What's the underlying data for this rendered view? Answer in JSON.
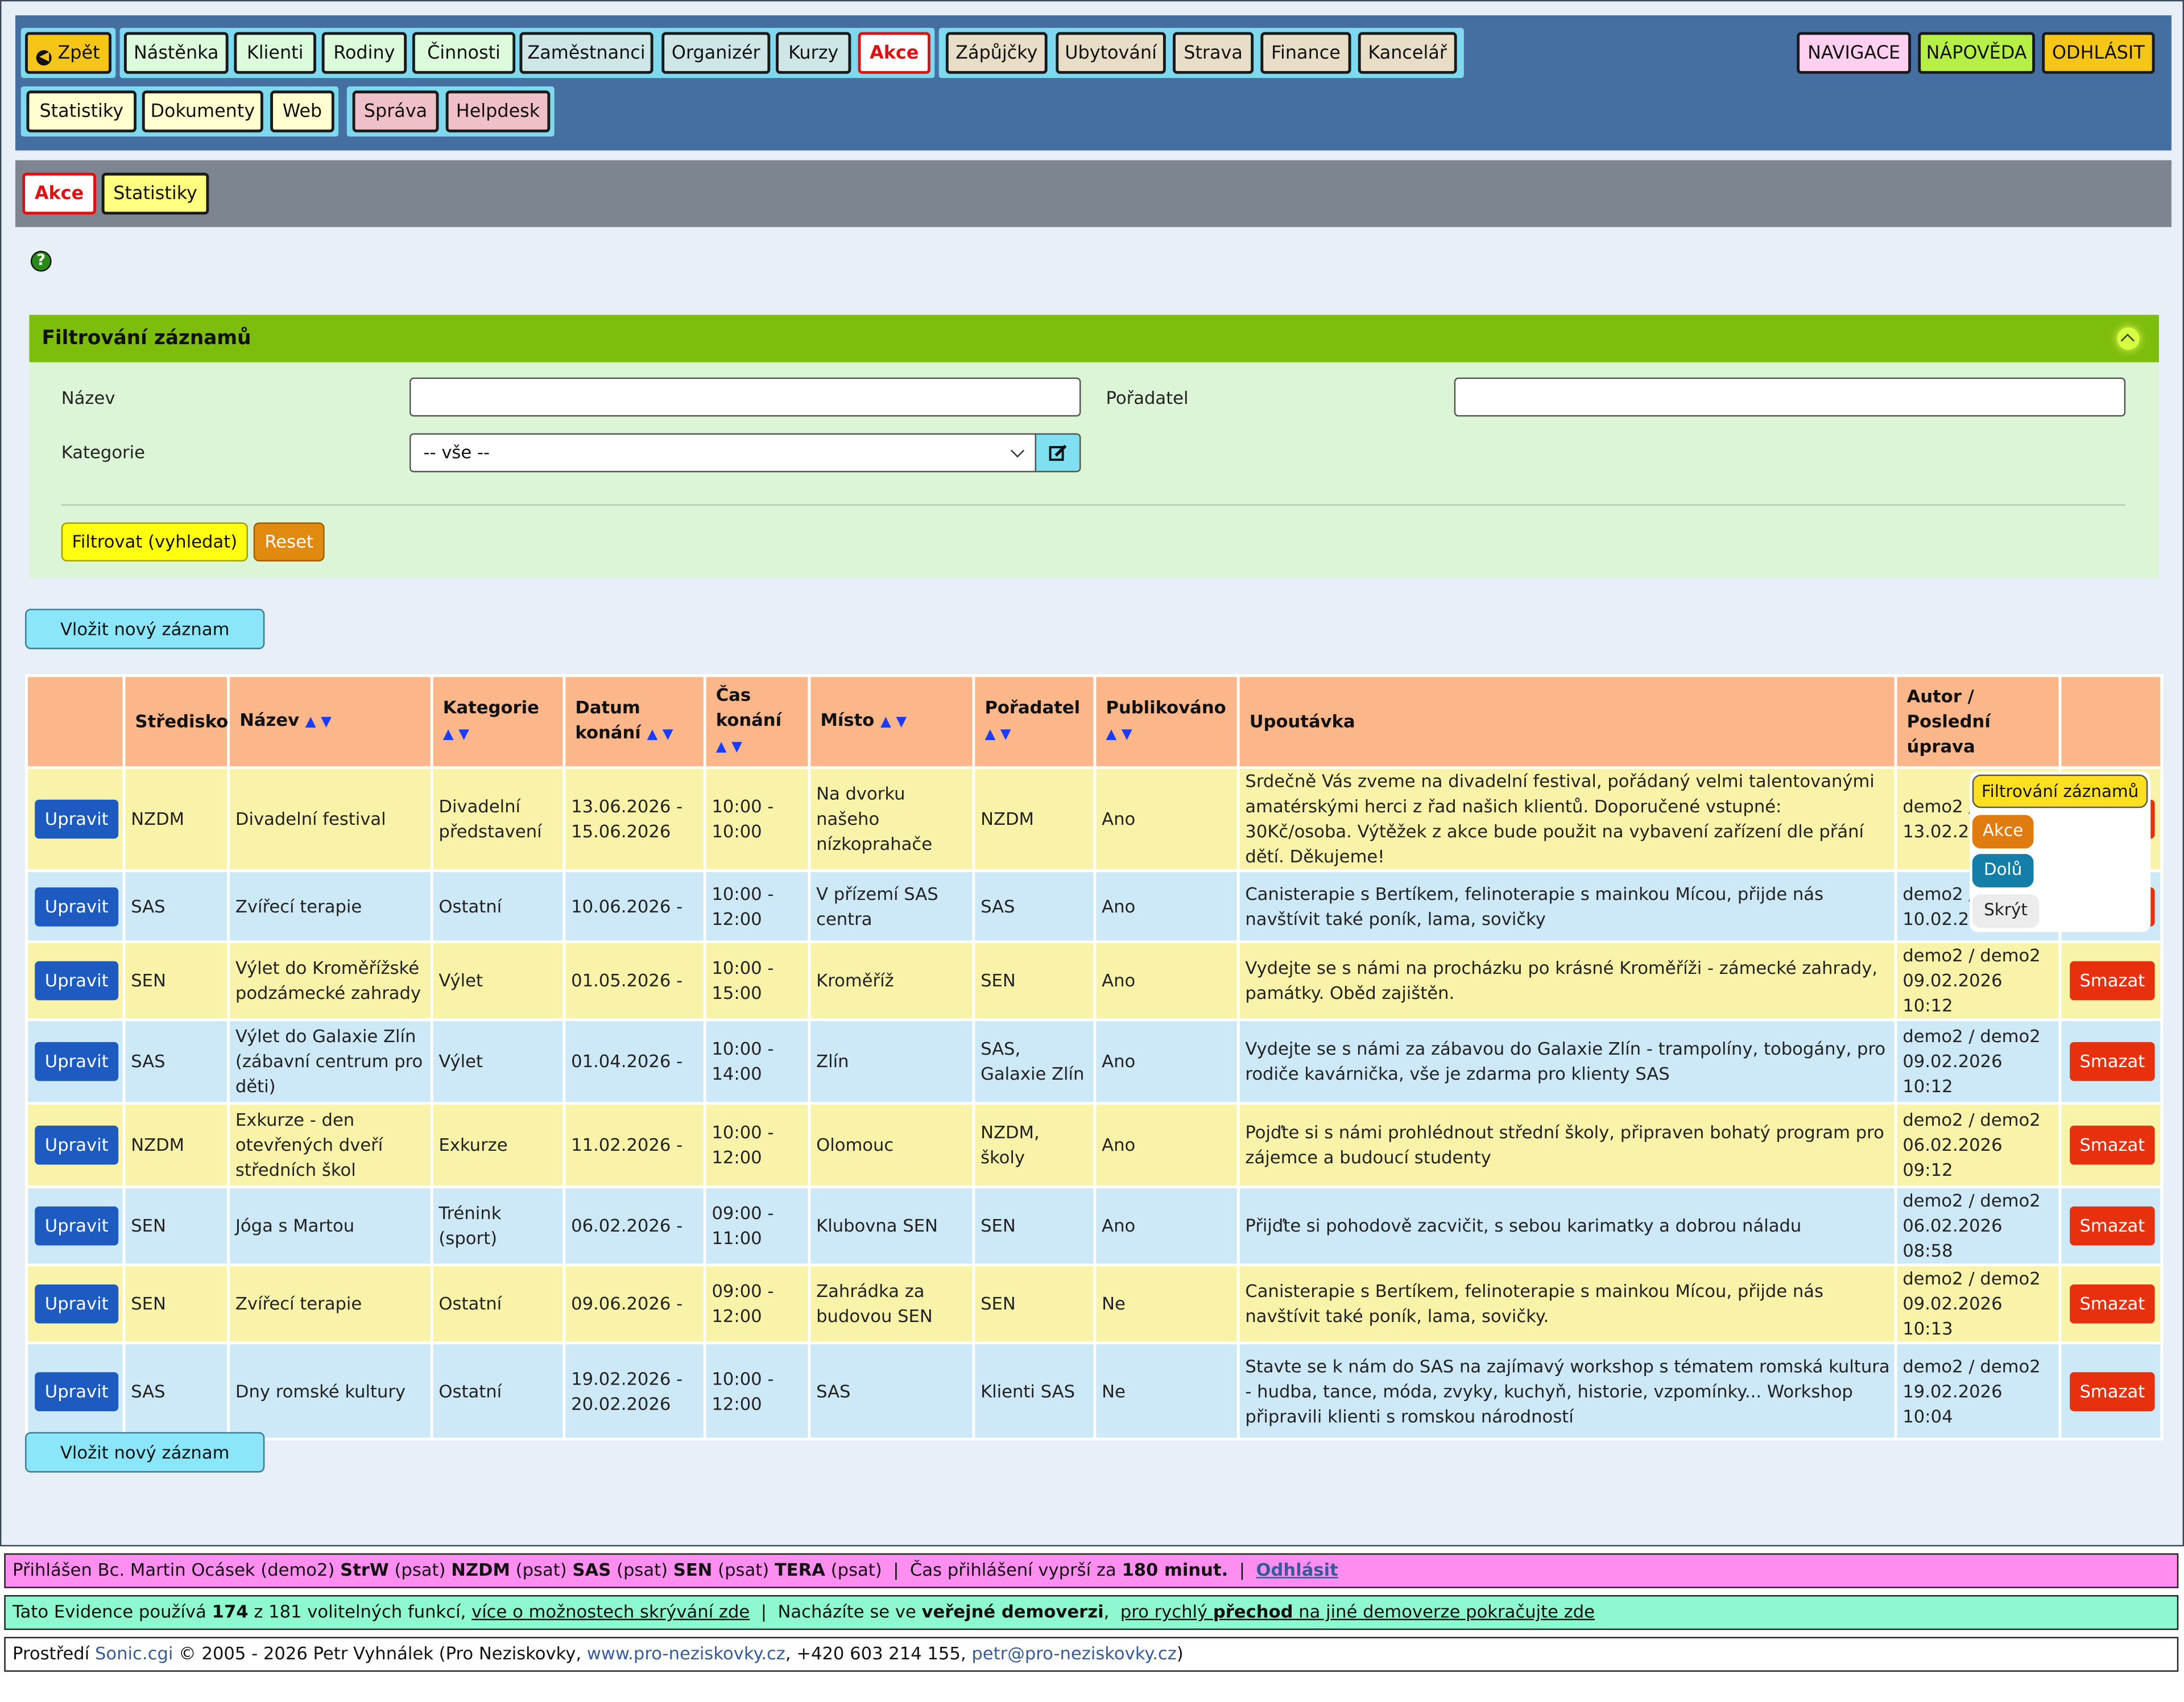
{
  "nav": {
    "back": "Zpět",
    "row1_group1": [
      "Nástěnka",
      "Klienti",
      "Rodiny",
      "Činnosti"
    ],
    "row1_group2": [
      "Zaměstnanci",
      "Organizér",
      "Kurzy",
      "Akce"
    ],
    "row1_group3": [
      "Zápůjčky",
      "Ubytování",
      "Strava",
      "Finance",
      "Kancelář"
    ],
    "row2_group1": [
      "Statistiky",
      "Dokumenty",
      "Web"
    ],
    "row2_group2": [
      "Správa",
      "Helpdesk"
    ],
    "right": [
      "NAVIGACE",
      "NÁPOVĚDA",
      "ODHLÁSIT"
    ]
  },
  "subnav": {
    "items": [
      "Akce",
      "Statistiky"
    ]
  },
  "filter": {
    "title": "Filtrování záznamů",
    "label_name": "Název",
    "label_organizer": "Pořadatel",
    "label_category": "Kategorie",
    "category_value": "-- vše --",
    "name_value": "",
    "organizer_value": "",
    "search_btn": "Filtrovat (vyhledat)",
    "reset_btn": "Reset"
  },
  "new_record": "Vložit nový záznam",
  "table": {
    "headers": [
      "",
      "Středisko",
      "Název",
      "Kategorie",
      "Datum konání",
      "Čas konání",
      "Místo",
      "Pořadatel",
      "Publikováno",
      "Upoutávka",
      "Autor / Poslední úprava",
      ""
    ],
    "edit_label": "Upravit",
    "delete_label": "Smazat",
    "rows": [
      {
        "center": "NZDM",
        "name": "Divadelní festival",
        "category": "Divadelní představení",
        "date": "13.06.2026 - 15.06.2026",
        "time": "10:00 - 10:00",
        "place": "Na dvorku našeho nízkoprahače",
        "organizer": "NZDM",
        "published": "Ano",
        "teaser": "Srdečně Vás zveme na divadelní festival, pořádaný velmi talentovanými amatérskými herci z řad našich klientů. Doporučené vstupné: 30Kč/osoba. Výtěžek z akce bude použit na vybavení zařízení dle přání dětí. Děkujeme!",
        "author": "demo2 / demo2 13.02.2026"
      },
      {
        "center": "SAS",
        "name": "Zvířecí terapie",
        "category": "Ostatní",
        "date": "10.06.2026 -",
        "time": "10:00 - 12:00",
        "place": "V přízemí SAS centra",
        "organizer": "SAS",
        "published": "Ano",
        "teaser": "Canisterapie s Bertíkem, felinoterapie s mainkou Mícou, přijde nás navštívit také poník, lama, sovičky",
        "author": "demo2 / demo2 10.02.2026"
      },
      {
        "center": "SEN",
        "name": "Výlet do Kroměřížské podzámecké zahrady",
        "category": "Výlet",
        "date": "01.05.2026 -",
        "time": "10:00 - 15:00",
        "place": "Kroměříž",
        "organizer": "SEN",
        "published": "Ano",
        "teaser": "Vydejte se s námi na procházku po krásné Kroměříži - zámecké zahrady, památky. Oběd zajištěn.",
        "author": "demo2 / demo2 09.02.2026 10:12"
      },
      {
        "center": "SAS",
        "name": "Výlet do Galaxie Zlín (zábavní centrum pro děti)",
        "category": "Výlet",
        "date": "01.04.2026 -",
        "time": "10:00 - 14:00",
        "place": "Zlín",
        "organizer": "SAS, Galaxie Zlín",
        "published": "Ano",
        "teaser": "Vydejte se s námi za zábavou do Galaxie Zlín - trampolíny, tobogány, pro rodiče kavárnička, vše je zdarma pro klienty SAS",
        "author": "demo2 / demo2 09.02.2026 10:12"
      },
      {
        "center": "NZDM",
        "name": "Exkurze - den otevřených dveří středních škol",
        "category": "Exkurze",
        "date": "11.02.2026 -",
        "time": "10:00 - 12:00",
        "place": "Olomouc",
        "organizer": "NZDM, školy",
        "published": "Ano",
        "teaser": "Pojďte si s námi prohlédnout střední školy, připraven bohatý program pro zájemce a budoucí studenty",
        "author": "demo2 / demo2 06.02.2026 09:12"
      },
      {
        "center": "SEN",
        "name": "Jóga s Martou",
        "category": "Trénink (sport)",
        "date": "06.02.2026 -",
        "time": "09:00 - 11:00",
        "place": "Klubovna SEN",
        "organizer": "SEN",
        "published": "Ano",
        "teaser": "Přijďte si pohodově zacvičit, s sebou karimatky a dobrou náladu",
        "author": "demo2 / demo2 06.02.2026 08:58"
      },
      {
        "center": "SEN",
        "name": "Zvířecí terapie",
        "category": "Ostatní",
        "date": "09.06.2026 -",
        "time": "09:00 - 12:00",
        "place": "Zahrádka za budovou SEN",
        "organizer": "SEN",
        "published": "Ne",
        "teaser": "Canisterapie s Bertíkem, felinoterapie s mainkou Mícou, přijde nás navštívit také poník, lama, sovičky.",
        "author": "demo2 / demo2 09.02.2026 10:13"
      },
      {
        "center": "SAS",
        "name": "Dny romské kultury",
        "category": "Ostatní",
        "date": "19.02.2026 - 20.02.2026",
        "time": "10:00 - 12:00",
        "place": "SAS",
        "organizer": "Klienti SAS",
        "published": "Ne",
        "teaser": "Stavte se k nám do SAS na zajímavý workshop s tématem romská kultura - hudba, tance, móda, zvyky, kuchyň, historie, vzpomínky... Workshop připravili klienti s romskou národností",
        "author": "demo2 / demo2 19.02.2026 10:04"
      }
    ]
  },
  "popup": {
    "items": [
      "Filtrování záznamů",
      "Akce",
      "Dolů",
      "Skrýt"
    ]
  },
  "footer": {
    "line1": {
      "a": "Přihlášen Bc. Martin Ocásek (demo2) ",
      "b": "StrW",
      "c": " (psat) ",
      "d": "NZDM",
      "e": " (psat) ",
      "f": "SAS",
      "g": " (psat) ",
      "h": "SEN",
      "i": " (psat) ",
      "j": "TERA",
      "k": " (psat)  |  Čas přihlášení vyprší za ",
      "l": "180 minut.",
      "m": "  |  ",
      "logout": "Odhlásit"
    },
    "line2": {
      "a": "Tato Evidence používá ",
      "b": "174",
      "c": " z 181 volitelných funkcí, ",
      "d": "více o možnostech skrývání zde",
      "e": "  |  Nacházíte se ve ",
      "f": "veřejné demoverzi",
      "g": ",  ",
      "h": "pro rychlý ",
      "i": "přechod",
      "j": " na jiné demoverze pokračujte zde"
    },
    "line3": {
      "a": "Prostředí ",
      "b": "Sonic.cgi",
      "c": " © 2005 - 2026 Petr Vyhnálek (Pro Neziskovky, ",
      "d": "www.pro-neziskovky.cz",
      "e": ", +420 603 214 155, ",
      "f": "petr@pro-neziskovky.cz",
      "g": ")"
    }
  },
  "colors": {
    "topbar": "#456fa0",
    "subbar": "#7c8590",
    "filter_head": "#7dbd0c",
    "filter_body": "#dcf5d6",
    "table_head": "#fbb68a",
    "row_yellow": "#f8f3a8",
    "row_blue": "#cde8f7",
    "edit": "#1d5bc0",
    "delete": "#e6300e",
    "footer1": "#ff8ef0",
    "footer2": "#8ef8d0"
  }
}
